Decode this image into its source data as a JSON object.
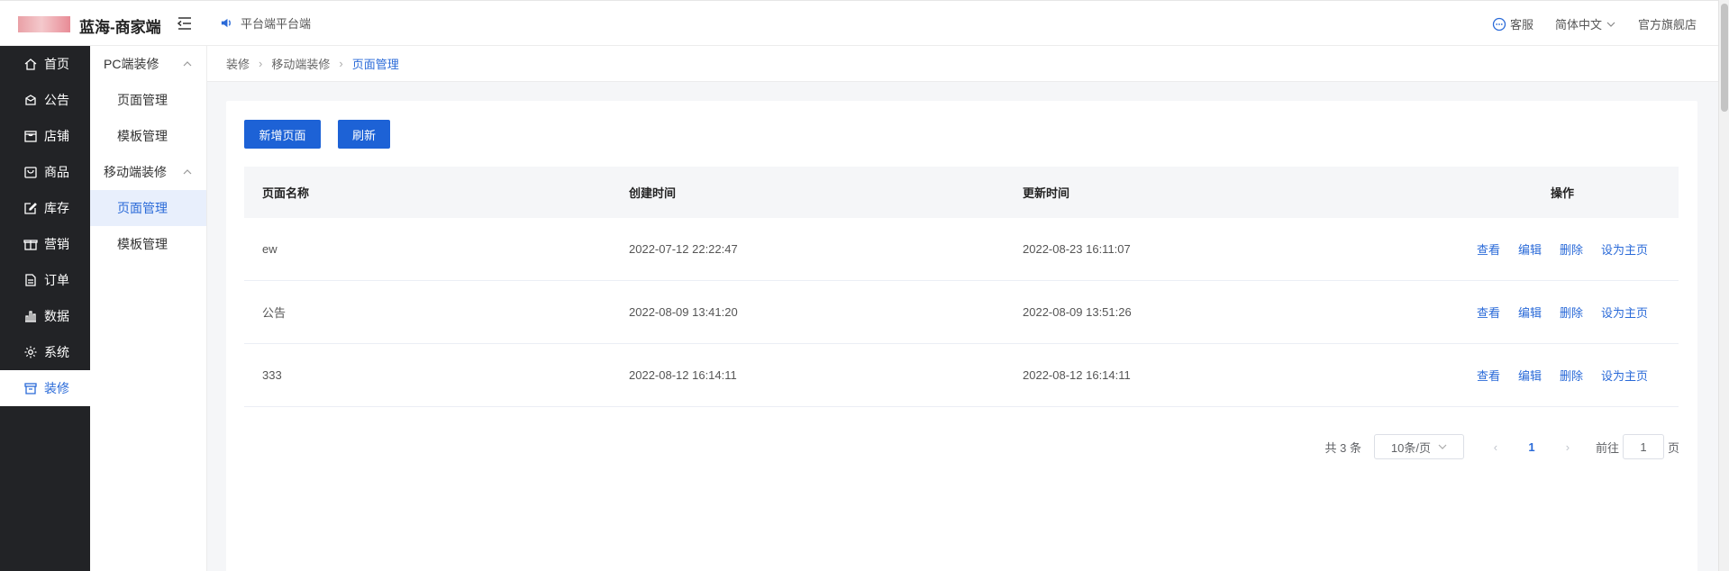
{
  "header": {
    "app_title": "蓝海-商家端",
    "notice": "平台端平台端",
    "customer_service": "客服",
    "language": "简体中文",
    "flagship_store": "官方旗舰店"
  },
  "sidebar": {
    "items": [
      {
        "label": "首页",
        "icon": "home-icon"
      },
      {
        "label": "公告",
        "icon": "announcement-icon"
      },
      {
        "label": "店铺",
        "icon": "shop-icon"
      },
      {
        "label": "商品",
        "icon": "bag-icon"
      },
      {
        "label": "库存",
        "icon": "edit-icon"
      },
      {
        "label": "营销",
        "icon": "gift-icon"
      },
      {
        "label": "订单",
        "icon": "document-icon"
      },
      {
        "label": "数据",
        "icon": "bar-chart-icon"
      },
      {
        "label": "系统",
        "icon": "gear-icon"
      },
      {
        "label": "装修",
        "icon": "decoration-icon",
        "active": true
      }
    ]
  },
  "submenu": {
    "groups": [
      {
        "label": "PC端装修",
        "items": [
          "页面管理",
          "模板管理"
        ]
      },
      {
        "label": "移动端装修",
        "items": [
          "页面管理",
          "模板管理"
        ]
      }
    ],
    "active": "移动端装修/页面管理"
  },
  "breadcrumb": {
    "items": [
      "装修",
      "移动端装修",
      "页面管理"
    ]
  },
  "toolbar": {
    "add_label": "新增页面",
    "refresh_label": "刷新"
  },
  "table": {
    "headers": [
      "页面名称",
      "创建时间",
      "更新时间",
      "操作"
    ],
    "rows": [
      {
        "name": "ew",
        "created": "2022-07-12 22:22:47",
        "updated": "2022-08-23 16:11:07"
      },
      {
        "name": "公告",
        "created": "2022-08-09 13:41:20",
        "updated": "2022-08-09 13:51:26"
      },
      {
        "name": "333",
        "created": "2022-08-12 16:14:11",
        "updated": "2022-08-12 16:14:11"
      }
    ],
    "actions": [
      "查看",
      "编辑",
      "删除",
      "设为主页"
    ]
  },
  "pagination": {
    "total": "共 3 条",
    "page_size": "10条/页",
    "current_page": "1",
    "goto_prefix": "前往",
    "goto_value": "1",
    "goto_suffix": "页"
  },
  "colors": {
    "primary": "#1d62d6",
    "sidebar_bg": "#222326",
    "active_text": "#2a6ad8"
  }
}
